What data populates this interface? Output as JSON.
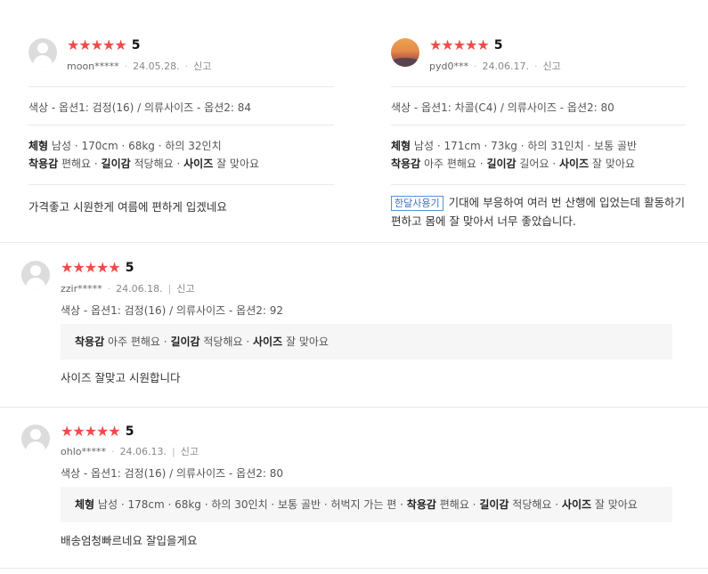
{
  "colors": {
    "star": "#f04b4b",
    "tag": "#3d72c4",
    "divider": "#e9e9e9"
  },
  "reviews": [
    {
      "score": "5",
      "user": "moon*****",
      "date": "24.05.28.",
      "report": "신고",
      "option": "색상 - 옵션1: 검정(16) / 의류사이즈 - 옵션2: 84",
      "spec_body_label": "체형",
      "spec_body_value": "남성 · 170cm · 68kg · 하의 32인치",
      "fit_label_1": "착용감",
      "fit_value_1": "편해요 ·",
      "fit_label_2": "길이감",
      "fit_value_2": "적당해요 ·",
      "fit_label_3": "사이즈",
      "fit_value_3": "잘 맞아요",
      "text": "가격좋고 시원한게 여름에 편하게 입겠네요"
    },
    {
      "score": "5",
      "user": "pyd0***",
      "date": "24.06.17.",
      "report": "신고",
      "option": "색상 - 옵션1: 차콜(C4) / 의류사이즈 - 옵션2: 80",
      "spec_body_label": "체형",
      "spec_body_value": "남성 · 171cm · 73kg · 하의 31인치 · 보통 골반",
      "fit_label_1": "착용감",
      "fit_value_1": "아주 편해요 ·",
      "fit_label_2": "길이감",
      "fit_value_2": "길어요 ·",
      "fit_label_3": "사이즈",
      "fit_value_3": "잘 맞아요",
      "tag": "한달사용기",
      "text": "기대에 부응하여 여러 번 산행에 입었는데 활동하기 편하고 몸에 잘 맞아서 너무 좋았습니다."
    },
    {
      "score": "5",
      "user": "zzir*****",
      "date": "24.06.18.",
      "report": "신고",
      "option": "색상 - 옵션1: 검정(16) / 의류사이즈 - 옵션2: 92",
      "fit_label_1": "착용감",
      "fit_value_1": "아주 편해요 ·",
      "fit_label_2": "길이감",
      "fit_value_2": "적당해요 ·",
      "fit_label_3": "사이즈",
      "fit_value_3": "잘 맞아요",
      "text": "사이즈 잘맞고 시원합니다"
    },
    {
      "score": "5",
      "user": "ohlo*****",
      "date": "24.06.13.",
      "report": "신고",
      "option": "색상 - 옵션1: 검정(16) / 의류사이즈 - 옵션2: 80",
      "spec_body_label": "체형",
      "spec_body_value": "남성 · 178cm · 68kg · 하의 30인치 · 보통 골반 · 허벅지 가는 편 ·",
      "fit_label_1": "착용감",
      "fit_value_1": "편해요 ·",
      "fit_label_2": "길이감",
      "fit_value_2": "적당해요 ·",
      "fit_label_3": "사이즈",
      "fit_value_3": "잘 맞아요",
      "text": "배송엄청빠르네요 잘입을게요"
    }
  ],
  "star_icon": "star-icon"
}
